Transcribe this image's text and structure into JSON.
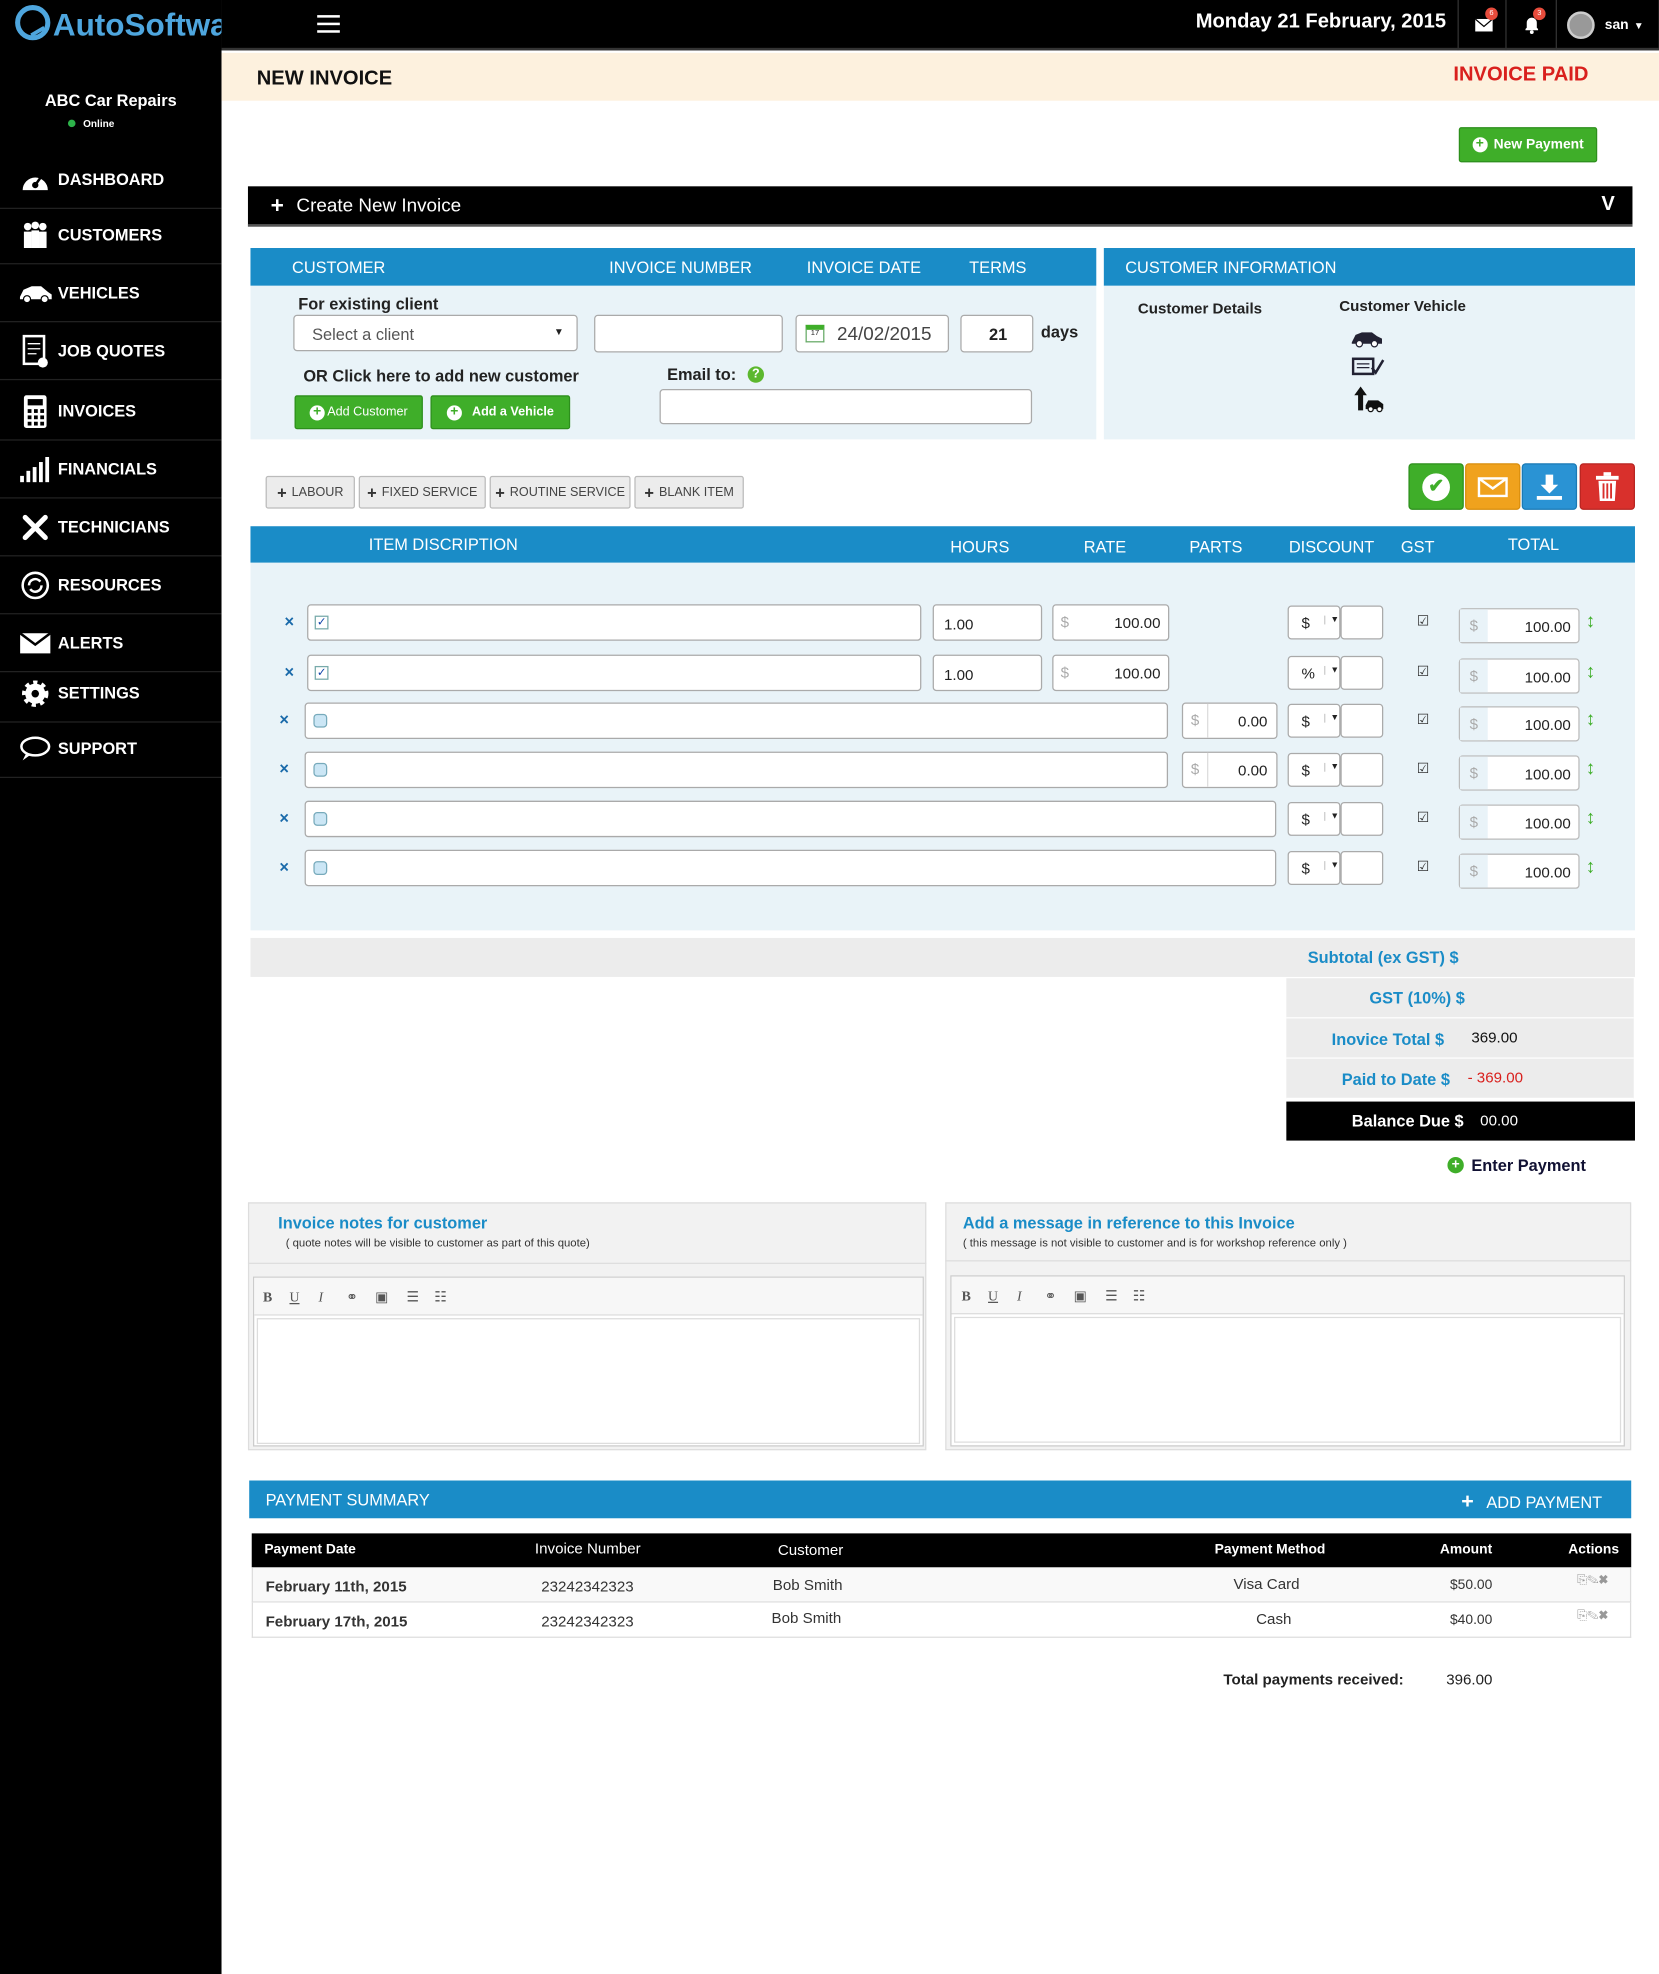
{
  "app": {
    "logo_text": "AutoSoftware",
    "company": "ABC Car Repairs",
    "status": "Online"
  },
  "topbar": {
    "date": "Monday 21 February, 2015",
    "mail_count": "6",
    "bell_count": "3",
    "user": "san"
  },
  "sidebar": {
    "items": [
      {
        "label": "DASHBOARD",
        "icon": "dashboard-icon"
      },
      {
        "label": "CUSTOMERS",
        "icon": "customers-icon"
      },
      {
        "label": "VEHICLES",
        "icon": "car-icon"
      },
      {
        "label": "JOB QUOTES",
        "icon": "job-quotes-icon"
      },
      {
        "label": "INVOICES",
        "icon": "calculator-icon"
      },
      {
        "label": "FINANCIALS",
        "icon": "bar-chart-icon"
      },
      {
        "label": "TECHNICIANS",
        "icon": "tools-icon"
      },
      {
        "label": "RESOURCES",
        "icon": "resources-icon"
      },
      {
        "label": "ALERTS",
        "icon": "envelope-icon"
      },
      {
        "label": "SETTINGS",
        "icon": "gear-icon"
      },
      {
        "label": "SUPPORT",
        "icon": "chat-icon"
      }
    ]
  },
  "page": {
    "title": "NEW INVOICE",
    "status": "INVOICE PAID",
    "new_payment": "New Payment",
    "create_label": "Create New  Invoice"
  },
  "invoice_form": {
    "headers": {
      "customer": "CUSTOMER",
      "invoice_number": "INVOICE  NUMBER",
      "invoice_date": "INVOICE  DATE",
      "terms": "TERMS"
    },
    "existing_client_label": "For existing client",
    "client_select": "Select a client",
    "invoice_date_value": "24/02/2015",
    "terms_value": "21",
    "terms_unit": "days",
    "add_new_label": "OR Click here to add new customer",
    "add_customer": "Add Customer",
    "add_vehicle": "Add a Vehicle",
    "email_label": "Email to:"
  },
  "customer_info": {
    "title": "CUSTOMER INFORMATION",
    "details": "Customer Details",
    "vehicle": "Customer  Vehicle"
  },
  "item_buttons": [
    "LABOUR",
    "FIXED SERVICE",
    "ROUTINE SERVICE",
    "BLANK ITEM"
  ],
  "items_header": {
    "description": "ITEM DISCRIPTION",
    "hours": "HOURS",
    "rate": "RATE",
    "parts": "PARTS",
    "discount": "DISCOUNT",
    "gst": "GST",
    "total": "TOTAL"
  },
  "currency_symbol": "$",
  "rows": [
    {
      "hours": "1.00",
      "rate": "100.00",
      "parts": "",
      "disc_type": "$",
      "total": "100.00"
    },
    {
      "hours": "1.00",
      "rate": "100.00",
      "parts": "",
      "disc_type": "%",
      "total": "100.00"
    },
    {
      "hours": "",
      "rate": "",
      "parts": "0.00",
      "disc_type": "$",
      "total": "100.00"
    },
    {
      "hours": "",
      "rate": "",
      "parts": "0.00",
      "disc_type": "$",
      "total": "100.00"
    },
    {
      "hours": "",
      "rate": "",
      "parts": "",
      "disc_type": "$",
      "total": "100.00"
    },
    {
      "hours": "",
      "rate": "",
      "parts": "",
      "disc_type": "$",
      "total": "100.00"
    }
  ],
  "summary": {
    "subtotal_label": "Subtotal (ex GST) $",
    "gst_label": "GST (10%) $",
    "total_label": "Inovice Total $",
    "total_value": "369.00",
    "paid_label": "Paid to Date $",
    "paid_value": "- 369.00",
    "balance_label": "Balance Due $",
    "balance_value": "00.00",
    "enter_payment": "Enter Payment"
  },
  "notes": {
    "customer_title": "Invoice notes for customer",
    "customer_sub": "( quote notes will be visible to customer as part of this quote)",
    "message_title": "Add a message in reference to this Invoice",
    "message_sub": "( this message is not visible to customer and is for workshop reference only )"
  },
  "payment_summary": {
    "title": "PAYMENT SUMMARY",
    "add": "ADD PAYMENT",
    "columns": [
      "Payment Date",
      "Invoice Number",
      "Customer",
      "Payment Method",
      "Amount",
      "Actions"
    ],
    "rows": [
      {
        "date": "February 11th, 2015",
        "number": "23242342323",
        "customer": "Bob Smith",
        "method": "Visa Card",
        "amount": "$50.00"
      },
      {
        "date": "February 17th, 2015",
        "number": "23242342323",
        "customer": "Bob Smith",
        "method": "Cash",
        "amount": "$40.00"
      }
    ],
    "total_label": "Total payments received:",
    "total_value": "396.00"
  }
}
